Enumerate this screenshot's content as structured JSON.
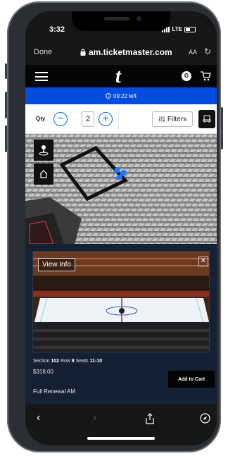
{
  "status_bar": {
    "time": "3:32",
    "network": "LTE"
  },
  "safari": {
    "done_label": "Done",
    "url": "am.ticketmaster.com",
    "text_size_label": "AA"
  },
  "header": {
    "logo": "t",
    "avatar_initial": "G"
  },
  "timer": {
    "text": "09:22 left"
  },
  "quantity": {
    "label": "Qty",
    "value": "2",
    "filters_label": "Filters"
  },
  "listing": {
    "view_info_label": "View Info",
    "section_label": "Section",
    "section": "102",
    "row_label": "Row",
    "row": "8",
    "seats_label": "Seats",
    "seats": "11-10",
    "price": "$318.00",
    "add_to_cart_label": "Add to Cart",
    "ticket_type": "Full Renewal AM"
  },
  "colors": {
    "brand_blue": "#024ddf",
    "accent_blue": "#026cdf",
    "panel_bg": "#142033"
  },
  "icons": [
    "lock-icon",
    "menu-icon",
    "cart-icon",
    "info-icon",
    "minus-icon",
    "plus-icon",
    "filter-icon",
    "seat-view-icon",
    "pin-icon",
    "home-icon",
    "close-icon",
    "back-icon",
    "forward-icon",
    "share-icon",
    "compass-icon"
  ]
}
